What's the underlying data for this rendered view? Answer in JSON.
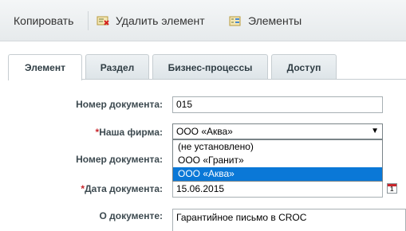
{
  "toolbar": {
    "copy_label": "Копировать",
    "delete_label": "Удалить элемент",
    "elements_label": "Элементы"
  },
  "tabs": [
    {
      "label": "Элемент",
      "active": true
    },
    {
      "label": "Раздел",
      "active": false
    },
    {
      "label": "Бизнес-процессы",
      "active": false
    },
    {
      "label": "Доступ",
      "active": false
    }
  ],
  "form": {
    "doc_number": {
      "label": "Номер документа:",
      "value": "015"
    },
    "firm": {
      "required_mark": "*",
      "label": "Наша фирма:",
      "value": "ООО «Аква»",
      "options": [
        "(не установлено)",
        "ООО «Гранит»",
        "ООО «Аква»"
      ],
      "selected_index": 2
    },
    "doc_number2": {
      "label": "Номер документа:"
    },
    "doc_date": {
      "required_mark": "*",
      "label": "Дата документа:",
      "value": "15.06.2015"
    },
    "about": {
      "label": "О документе:",
      "value": "Гарантийное письмо в CROC"
    }
  },
  "colors": {
    "accent": "#0a78d7",
    "required": "#c8262c"
  },
  "icons": {
    "delete": "delete-icon",
    "elements": "list-icon",
    "calendar": "calendar-icon"
  }
}
